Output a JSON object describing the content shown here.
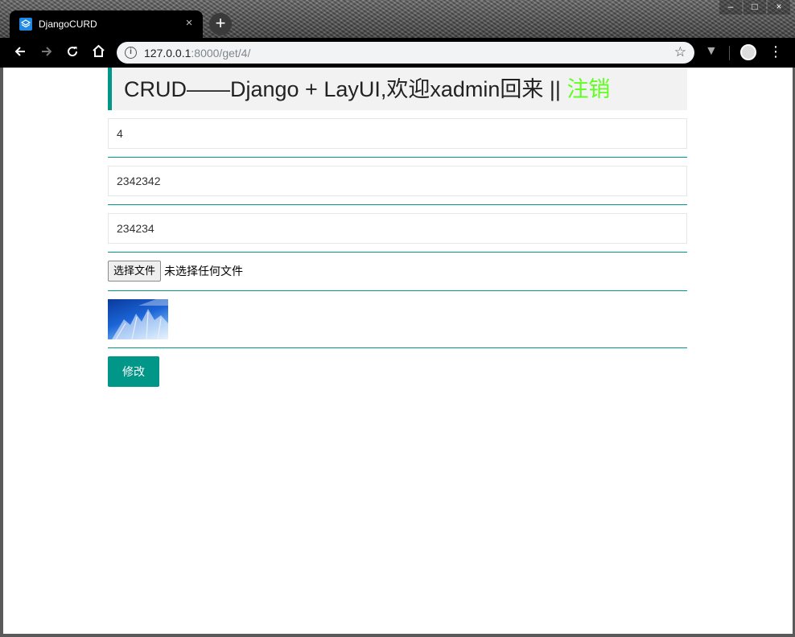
{
  "browser": {
    "tab_title": "DjangoCURD",
    "tab_close": "×",
    "new_tab": "+",
    "url_host": "127.0.0.1",
    "url_rest": ":8000/get/4/",
    "window_controls": [
      "–",
      "□",
      "×"
    ]
  },
  "header": {
    "title": "CRUD——Django + LayUI,欢迎xadmin回来 || ",
    "logout_link": "注销",
    "logout_color": "#5fff1f",
    "accent_color": "#009688"
  },
  "form": {
    "fields": [
      {
        "value": "4"
      },
      {
        "value": "2342342"
      },
      {
        "value": "234234"
      }
    ],
    "file_button_label": "选择文件",
    "file_status": "未选择任何文件",
    "submit_label": "修改"
  },
  "icons": {
    "back": "arrow-left-icon",
    "forward": "arrow-right-icon",
    "reload": "reload-icon",
    "home": "home-icon",
    "info": "info-icon",
    "bookmark": "star-icon",
    "extension": "extension-icon",
    "profile": "avatar",
    "menu": "kebab-menu-icon"
  }
}
